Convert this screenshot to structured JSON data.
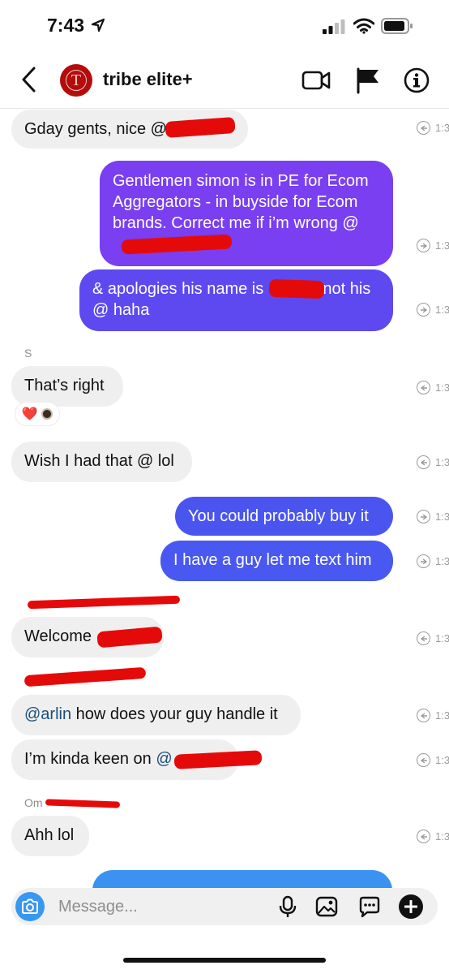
{
  "status_bar": {
    "time": "7:43"
  },
  "header": {
    "title": "tribe elite+",
    "avatar_letter": "T"
  },
  "messages": [
    {
      "text": "Gday gents, nice @",
      "ts": "1:3"
    },
    {
      "text": "Gentlemen simon is in PE for Ecom Aggregators - in buyside for Ecom brands. Correct me if i’m wrong @",
      "ts": "1:3"
    },
    {
      "text_a": "& apologies his name is",
      "text_b": "not his",
      "text_c": "@ haha",
      "ts": "1:3"
    },
    {
      "sender": "S",
      "text": "That’s right",
      "ts": "1:3"
    },
    {
      "text": "Wish I had that @ lol",
      "ts": "1:3"
    },
    {
      "text": "You could probably buy it",
      "ts": "1:3"
    },
    {
      "text": "I have a guy let me text him",
      "ts": "1:3"
    },
    {
      "text": "Welcome",
      "ts": "1:3"
    },
    {
      "mention": "@arlin",
      "text": " how does your guy handle it",
      "ts": "1:3"
    },
    {
      "text": "I’m kinda keen on ",
      "mention": "@",
      "ts": "1:3"
    },
    {
      "sender": "Om",
      "text": "Ahh lol",
      "ts": "1:3"
    }
  ],
  "reaction": {
    "emoji": "❤️"
  },
  "composer": {
    "placeholder": "Message..."
  },
  "colors": {
    "accent": "#3897f0",
    "outgoing_top": "#7a3ff0",
    "outgoing_bottom": "#4a55f0"
  }
}
